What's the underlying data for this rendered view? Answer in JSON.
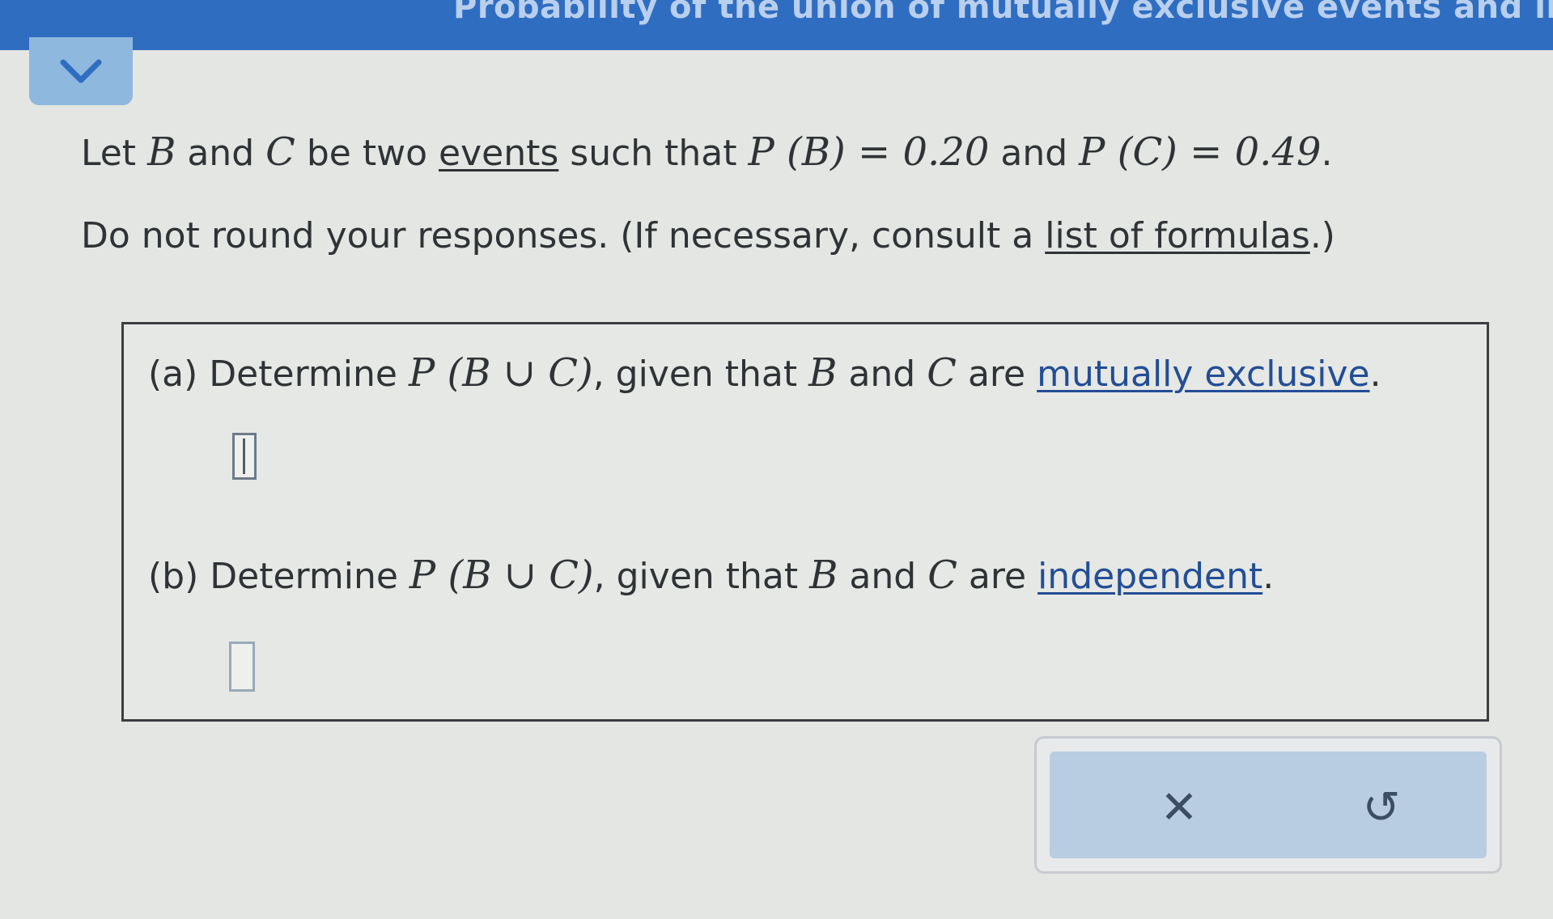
{
  "header": {
    "title": "Probability of the union of mutually exclusive events and independent..."
  },
  "problem": {
    "intro_let": "Let",
    "var_b": "B",
    "word_and": "and",
    "var_c": "C",
    "be_two": "be two",
    "events_link": "events",
    "such_that": "such that",
    "pb_expr": "P (B) = 0.20",
    "pc_expr": "P (C) = 0.49",
    "period": ".",
    "instruction": "Do not round your responses. (If necessary, consult a",
    "formulas_link": "list of formulas",
    "instruction_end": ".)"
  },
  "parts": [
    {
      "label": "(a)",
      "text_determine": "Determine",
      "expr": "P (B ∪ C)",
      "text_given": ", given that",
      "var_b": "B",
      "word_and": "and",
      "var_c": "C",
      "text_are": "are",
      "link": "mutually exclusive",
      "end": ".",
      "answer_value": ""
    },
    {
      "label": "(b)",
      "text_determine": "Determine",
      "expr": "P (B ∪ C)",
      "text_given": ", given that",
      "var_b": "B",
      "word_and": "and",
      "var_c": "C",
      "text_are": "are",
      "link": "independent",
      "end": ".",
      "answer_value": ""
    }
  ],
  "actions": {
    "clear_glyph": "✕",
    "undo_glyph": "↺"
  },
  "colors": {
    "header_bar": "#2f6dc1",
    "link_blue": "#234e96",
    "action_panel": "#b9cde2"
  }
}
